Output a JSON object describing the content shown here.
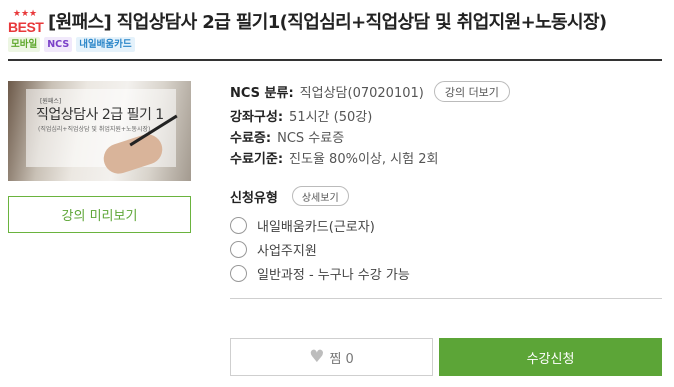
{
  "badge": {
    "stars": "★★★",
    "label": "BEST"
  },
  "course": {
    "title": "[원패스] 직업상담사 2급 필기1(직업심리+직업상담 및 취업지원+노동시장)"
  },
  "tags": [
    {
      "label": "모바일"
    },
    {
      "label": "NCS"
    },
    {
      "label": "내일배움카드"
    }
  ],
  "thumbnail": {
    "small": "[원패스]",
    "big": "직업상담사 2급 필기 1",
    "sub": "(직업심리+직업상담 및 취업지원+노동시장)"
  },
  "preview_label": "강의 미리보기",
  "details": {
    "ncs_key": "NCS 분류:",
    "ncs_value": "직업상담(07020101)",
    "more_button": "강의 더보기",
    "composition_key": "강좌구성:",
    "composition_value": "51시간 (50강)",
    "certificate_key": "수료증:",
    "certificate_value": "NCS 수료증",
    "criteria_key": "수료기준:",
    "criteria_value": "진도율 80%이상, 시험 2회"
  },
  "apply": {
    "label": "신청유형",
    "detail_button": "상세보기",
    "options": [
      {
        "label": "내일배움카드(근로자)"
      },
      {
        "label": "사업주지원"
      },
      {
        "label": "일반과정 - 누구나 수강 가능"
      }
    ]
  },
  "actions": {
    "like_icon": "heart-icon",
    "like_label": "찜 0",
    "enroll_label": "수강신청"
  },
  "colors": {
    "accent_green": "#5ca537",
    "best_red": "#e8393b"
  }
}
